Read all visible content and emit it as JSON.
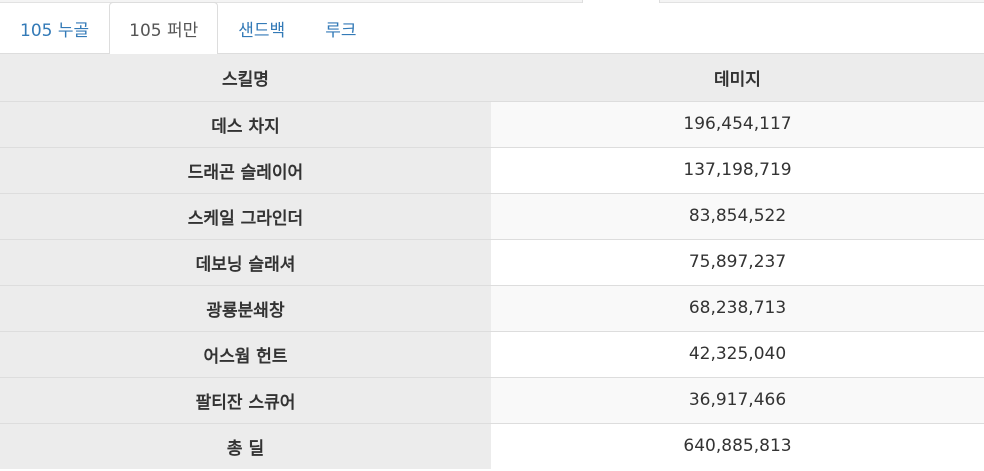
{
  "tabs": [
    {
      "label": "105 누골",
      "active": false
    },
    {
      "label": "105 퍼만",
      "active": true
    },
    {
      "label": "샌드백",
      "active": false
    },
    {
      "label": "루크",
      "active": false
    }
  ],
  "table": {
    "headers": [
      "스킬명",
      "데미지"
    ],
    "rows": [
      {
        "skill": "데스 차지",
        "damage": "196,454,117"
      },
      {
        "skill": "드래곤 슬레이어",
        "damage": "137,198,719"
      },
      {
        "skill": "스케일 그라인더",
        "damage": "83,854,522"
      },
      {
        "skill": "데보닝 슬래셔",
        "damage": "75,897,237"
      },
      {
        "skill": "광룡분쇄창",
        "damage": "68,238,713"
      },
      {
        "skill": "어스웜 헌트",
        "damage": "42,325,040"
      },
      {
        "skill": "팔티잔 스큐어",
        "damage": "36,917,466"
      },
      {
        "skill": "총 딜",
        "damage": "640,885,813"
      }
    ]
  },
  "colors": {
    "link": "#337ab7",
    "header_bg": "#ececec",
    "border": "#dddddd"
  }
}
